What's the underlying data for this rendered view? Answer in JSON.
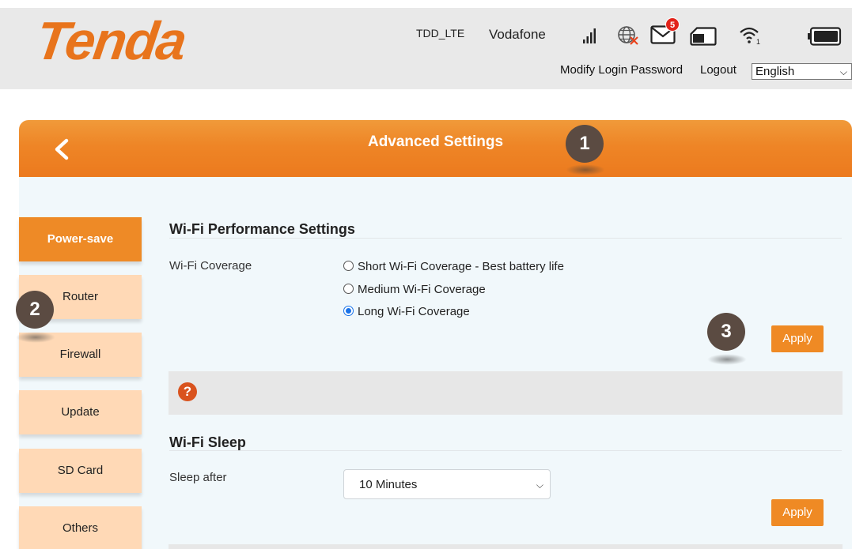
{
  "header": {
    "logo": "Tenda",
    "network_type": "TDD_LTE",
    "operator": "Vodafone",
    "message_count": "5",
    "modify_password_link": "Modify Login Password",
    "logout_link": "Logout",
    "language": "English",
    "icons": [
      "signal-icon",
      "globe-disconnected-icon",
      "mail-icon",
      "sim-card-icon",
      "wifi-icon",
      "battery-icon"
    ]
  },
  "titlebar": {
    "title": "Advanced Settings",
    "back_icon": "chevron-left-icon"
  },
  "sidebar": {
    "items": [
      {
        "label": "Power-save",
        "active": true
      },
      {
        "label": "Router",
        "active": false
      },
      {
        "label": "Firewall",
        "active": false
      },
      {
        "label": "Update",
        "active": false
      },
      {
        "label": "SD Card",
        "active": false
      },
      {
        "label": "Others",
        "active": false
      }
    ]
  },
  "markers": [
    "1",
    "2",
    "3"
  ],
  "wifi_performance": {
    "title": "Wi-Fi Performance Settings",
    "coverage_label": "Wi-Fi Coverage",
    "options": [
      {
        "label": "Short Wi-Fi Coverage - Best battery life",
        "checked": false
      },
      {
        "label": "Medium Wi-Fi Coverage",
        "checked": false
      },
      {
        "label": "Long Wi-Fi Coverage",
        "checked": true
      }
    ],
    "apply_label": "Apply",
    "help_symbol": "?"
  },
  "wifi_sleep": {
    "title": "Wi-Fi Sleep",
    "sleep_label": "Sleep after",
    "sleep_value": "10 Minutes",
    "apply_label": "Apply"
  },
  "colors": {
    "accent": "#ee8526",
    "sidebar_inactive": "#ffd9b6",
    "marker": "#5b4b42",
    "help": "#d9531e"
  }
}
